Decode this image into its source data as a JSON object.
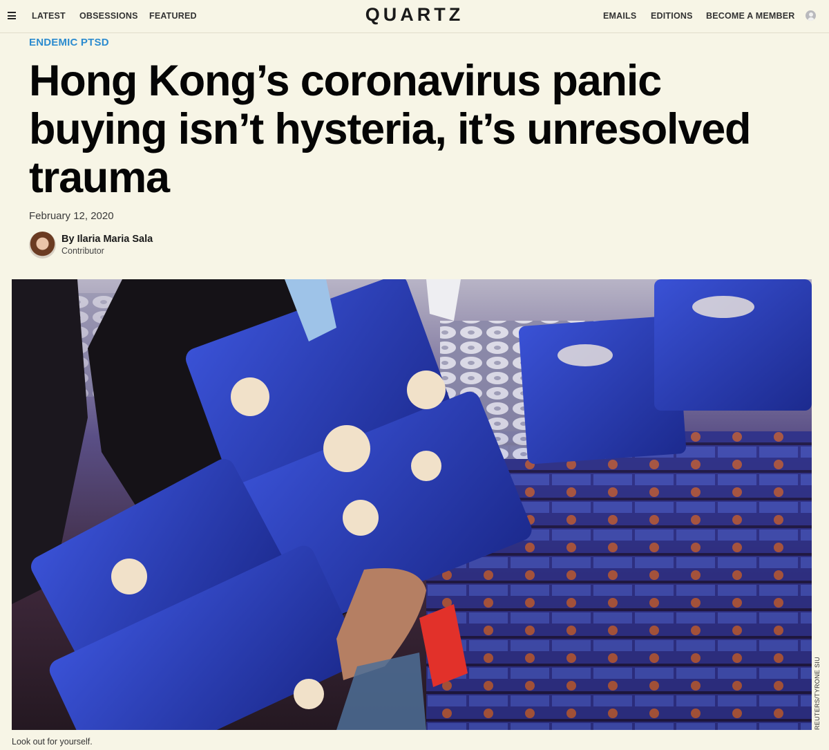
{
  "nav": {
    "left_links": [
      "LATEST",
      "OBSESSIONS",
      "FEATURED"
    ],
    "logo": "QUARTZ",
    "right_links": [
      "EMAILS",
      "EDITIONS",
      "BECOME A MEMBER"
    ]
  },
  "article": {
    "kicker": "ENDEMIC PTSD",
    "headline": "Hong Kong’s coronavirus panic buying isn’t hysteria, it’s unresolved trauma",
    "date": "February 12, 2020",
    "byline_prefix": "By",
    "author": "Ilaria Maria Sala",
    "author_role": "Contributor"
  },
  "image": {
    "credit": "REUTERS/TYRONE SIU",
    "caption": "Look out for yourself."
  }
}
